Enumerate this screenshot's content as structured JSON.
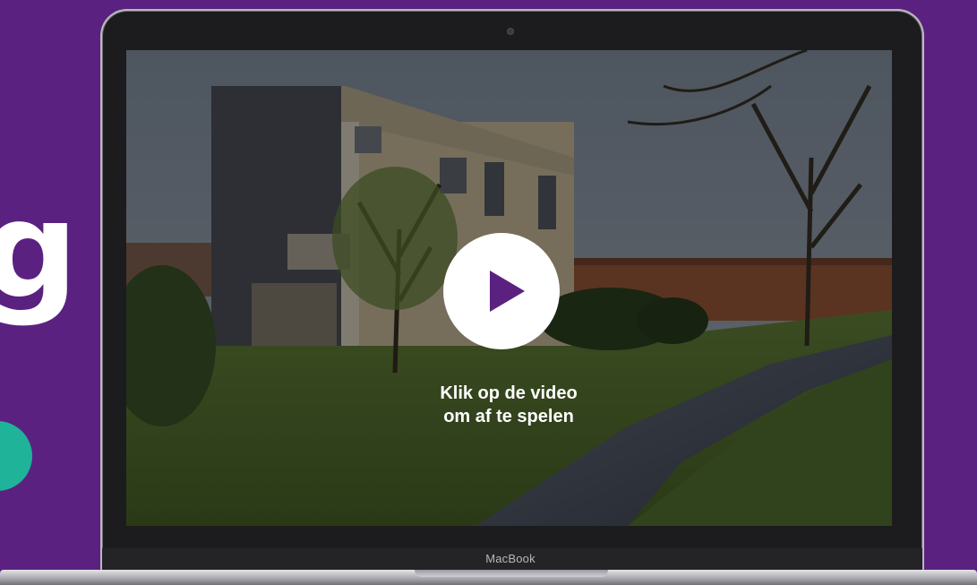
{
  "page": {
    "side_glyph": "g"
  },
  "laptop": {
    "brand": "MacBook"
  },
  "video": {
    "caption_line1": "Klik op de video",
    "caption_line2": "om af te spelen",
    "play_icon": "play-icon"
  },
  "colors": {
    "background": "#5b2180",
    "play_triangle": "#5b2180",
    "accent_dot": "#1fb39a"
  }
}
